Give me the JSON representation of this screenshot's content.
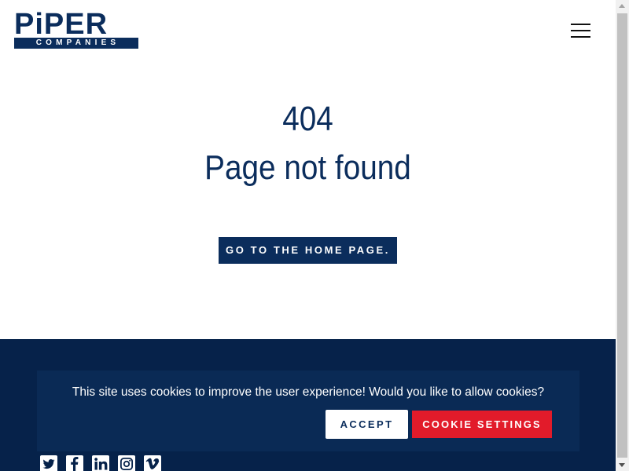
{
  "header": {
    "logo_top": "PiPER",
    "logo_bottom": "COMPANIES",
    "menu_icon": "hamburger-menu-icon"
  },
  "main": {
    "error_code": "404",
    "error_message": "Page not found",
    "home_button_label": "GO TO THE HOME PAGE."
  },
  "cookie_banner": {
    "message": "This site uses cookies to improve the user experience! Would you like to allow cookies?",
    "accept_label": "ACCEPT",
    "settings_label": "COOKIE SETTINGS"
  },
  "footer": {
    "social_icons": [
      "twitter-icon",
      "facebook-icon",
      "linkedin-icon",
      "instagram-icon",
      "vimeo-icon"
    ]
  },
  "colors": {
    "brand_navy": "#0b2d5c",
    "footer_navy": "#06224a",
    "accent_red": "#e21b2a",
    "white": "#ffffff"
  }
}
